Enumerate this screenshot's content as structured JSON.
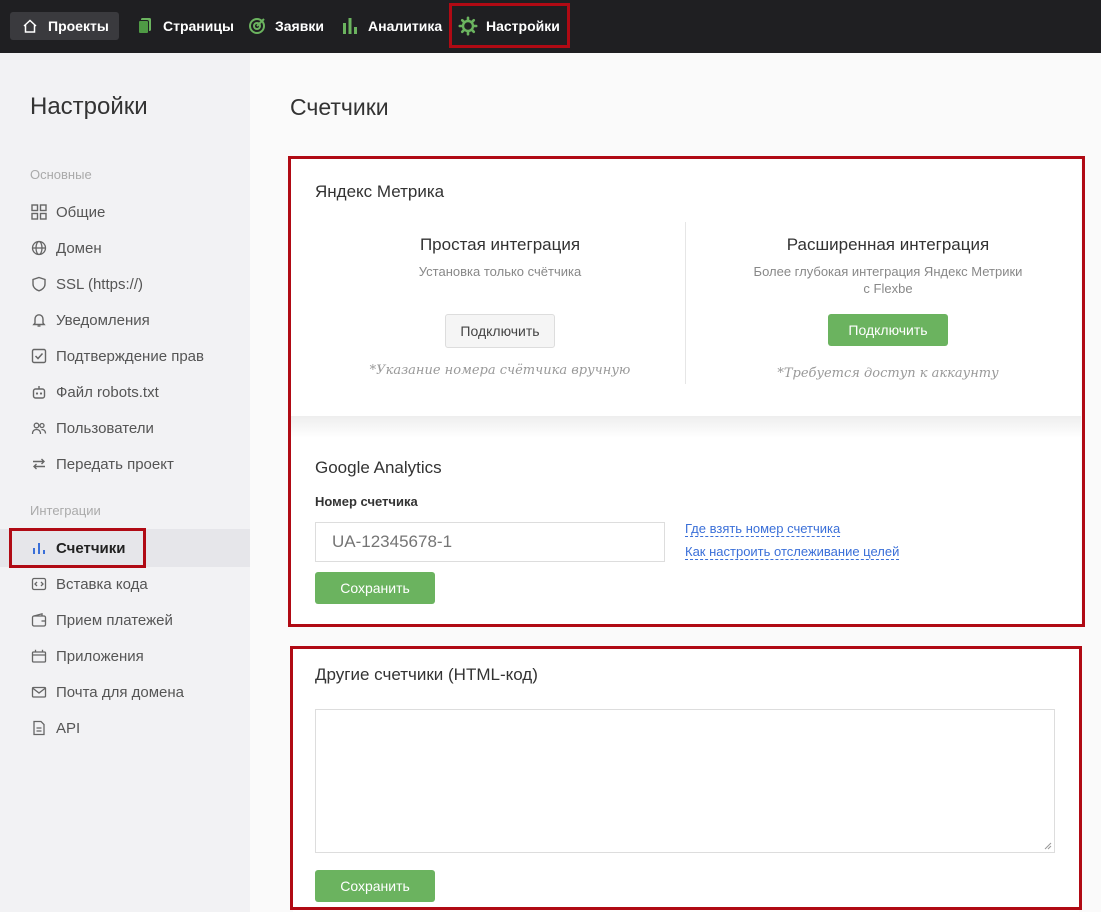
{
  "nav": {
    "items": [
      {
        "label": "Проекты",
        "icon": "home-icon"
      },
      {
        "label": "Страницы",
        "icon": "pages-icon"
      },
      {
        "label": "Заявки",
        "icon": "target-icon"
      },
      {
        "label": "Аналитика",
        "icon": "bar-chart-icon"
      },
      {
        "label": "Настройки",
        "icon": "gear-icon"
      }
    ]
  },
  "sidebar": {
    "title": "Настройки",
    "group_main": "Основные",
    "group_integrations": "Интеграции",
    "main_items": [
      {
        "label": "Общие",
        "icon": "grid-icon"
      },
      {
        "label": "Домен",
        "icon": "globe-icon"
      },
      {
        "label": "SSL (https://)",
        "icon": "shield-icon"
      },
      {
        "label": "Уведомления",
        "icon": "bell-icon"
      },
      {
        "label": "Подтверждение прав",
        "icon": "checkbox-icon"
      },
      {
        "label": "Файл robots.txt",
        "icon": "robot-icon"
      },
      {
        "label": "Пользователи",
        "icon": "users-icon"
      },
      {
        "label": "Передать проект",
        "icon": "transfer-icon"
      }
    ],
    "integration_items": [
      {
        "label": "Счетчики",
        "icon": "bar-chart-icon"
      },
      {
        "label": "Вставка кода",
        "icon": "code-icon"
      },
      {
        "label": "Прием платежей",
        "icon": "wallet-icon"
      },
      {
        "label": "Приложения",
        "icon": "apps-icon"
      },
      {
        "label": "Почта для домена",
        "icon": "mail-icon"
      },
      {
        "label": "API",
        "icon": "document-icon"
      }
    ]
  },
  "main": {
    "title": "Счетчики",
    "yandex": {
      "title": "Яндекс Метрика",
      "simple": {
        "title": "Простая интеграция",
        "subtitle": "Установка только счётчика",
        "button": "Подключить",
        "note": "*Указание номера счётчика вручную"
      },
      "advanced": {
        "title": "Расширенная интеграция",
        "subtitle_line1": "Более глубокая интеграция Яндекс Метрики",
        "subtitle_line2": "с Flexbe",
        "button": "Подключить",
        "note": "*Требуется доступ к аккаунту"
      }
    },
    "google": {
      "title": "Google Analytics",
      "field_label": "Номер счетчика",
      "placeholder": "UA-12345678-1",
      "link1": "Где взять номер счетчика",
      "link2": "Как настроить отслеживание целей",
      "save": "Сохранить"
    },
    "other": {
      "title": "Другие счетчики (HTML-код)",
      "save": "Сохранить"
    }
  },
  "colors": {
    "highlight": "#b00a14",
    "green": "#6bb35f",
    "link": "#3a6fd8"
  }
}
